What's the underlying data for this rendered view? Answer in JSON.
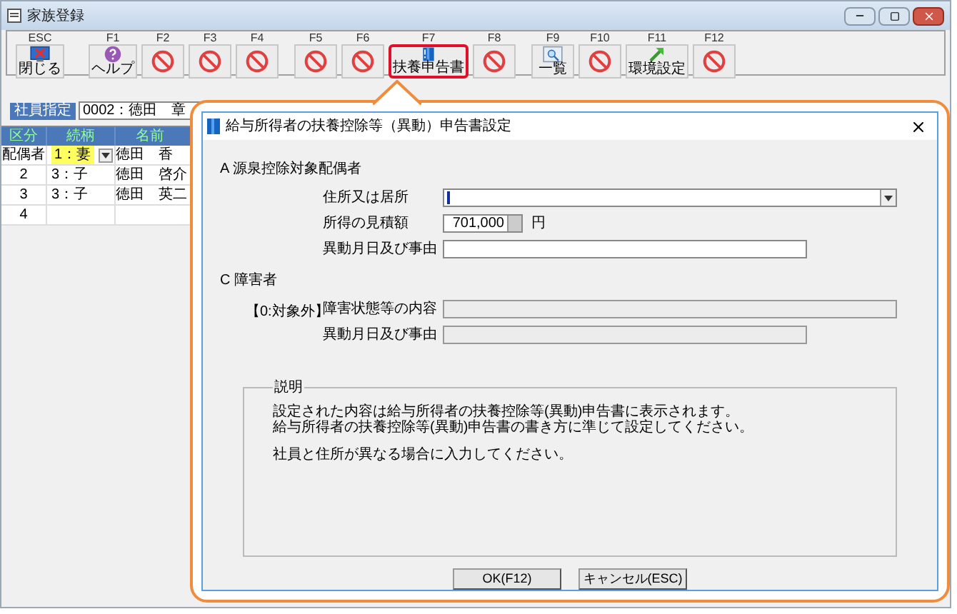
{
  "window": {
    "title": "家族登録"
  },
  "toolbar": [
    {
      "key": "ESC",
      "label": "閉じる",
      "kind": "close",
      "highlighted": false
    },
    {
      "key": "F1",
      "label": "ヘルプ",
      "kind": "help",
      "highlighted": false
    },
    {
      "key": "F2",
      "kind": "disabled",
      "highlighted": false
    },
    {
      "key": "F3",
      "kind": "disabled",
      "highlighted": false
    },
    {
      "key": "F4",
      "kind": "disabled",
      "highlighted": false
    },
    {
      "key": "F5",
      "kind": "disabled",
      "highlighted": false
    },
    {
      "key": "F6",
      "kind": "disabled",
      "highlighted": false
    },
    {
      "key": "F7",
      "label": "扶養申告書",
      "kind": "book",
      "highlighted": true
    },
    {
      "key": "F8",
      "kind": "disabled",
      "highlighted": false
    },
    {
      "key": "F9",
      "label": "一覧",
      "kind": "list",
      "highlighted": false
    },
    {
      "key": "F10",
      "kind": "disabled",
      "highlighted": false
    },
    {
      "key": "F11",
      "label": "環境設定",
      "kind": "arrow",
      "highlighted": false
    },
    {
      "key": "F12",
      "kind": "disabled",
      "highlighted": false
    }
  ],
  "employee": {
    "label": "社員指定",
    "value": "0002：徳田　章"
  },
  "grid": {
    "columns": [
      "区分",
      "続柄",
      "名前"
    ],
    "rows": [
      {
        "cells": [
          "配偶者",
          "1：妻",
          "徳田　香"
        ],
        "editing": true
      },
      {
        "cells": [
          "2",
          "3：子",
          "徳田　啓介"
        ],
        "editing": false
      },
      {
        "cells": [
          "3",
          "3：子",
          "徳田　英二"
        ],
        "editing": false
      },
      {
        "cells": [
          "4"
        ],
        "editing": false
      }
    ]
  },
  "dialog": {
    "title": "給与所得者の扶養控除等（異動）申告書設定",
    "sections": [
      {
        "heading": "A 源泉控除対象配偶者",
        "fields": [
          {
            "label": "住所又は居所",
            "kind": "combo",
            "focused": true,
            "disabled": false
          },
          {
            "label": "所得の見積額",
            "kind": "amount",
            "value": "701,000",
            "unit": "円",
            "disabled": false
          },
          {
            "label": "異動月日及び事由",
            "kind": "text",
            "disabled": false
          }
        ]
      },
      {
        "heading": "C 障害者",
        "status": "【0:対象外】",
        "fields": [
          {
            "label": "障害状態等の内容",
            "kind": "wide_text",
            "disabled": true
          },
          {
            "label": "異動月日及び事由",
            "kind": "text",
            "disabled": true
          }
        ]
      }
    ],
    "explanation": {
      "title": "説明",
      "lines": [
        "設定された内容は給与所得者の扶養控除等(異動)申告書に表示されます。",
        "給与所得者の扶養控除等(異動)申告書の書き方に準じて設定してください。",
        "社員と住所が異なる場合に入力してください。"
      ]
    },
    "buttons": [
      "OK(F12)",
      "キャンセル(ESC)"
    ]
  }
}
